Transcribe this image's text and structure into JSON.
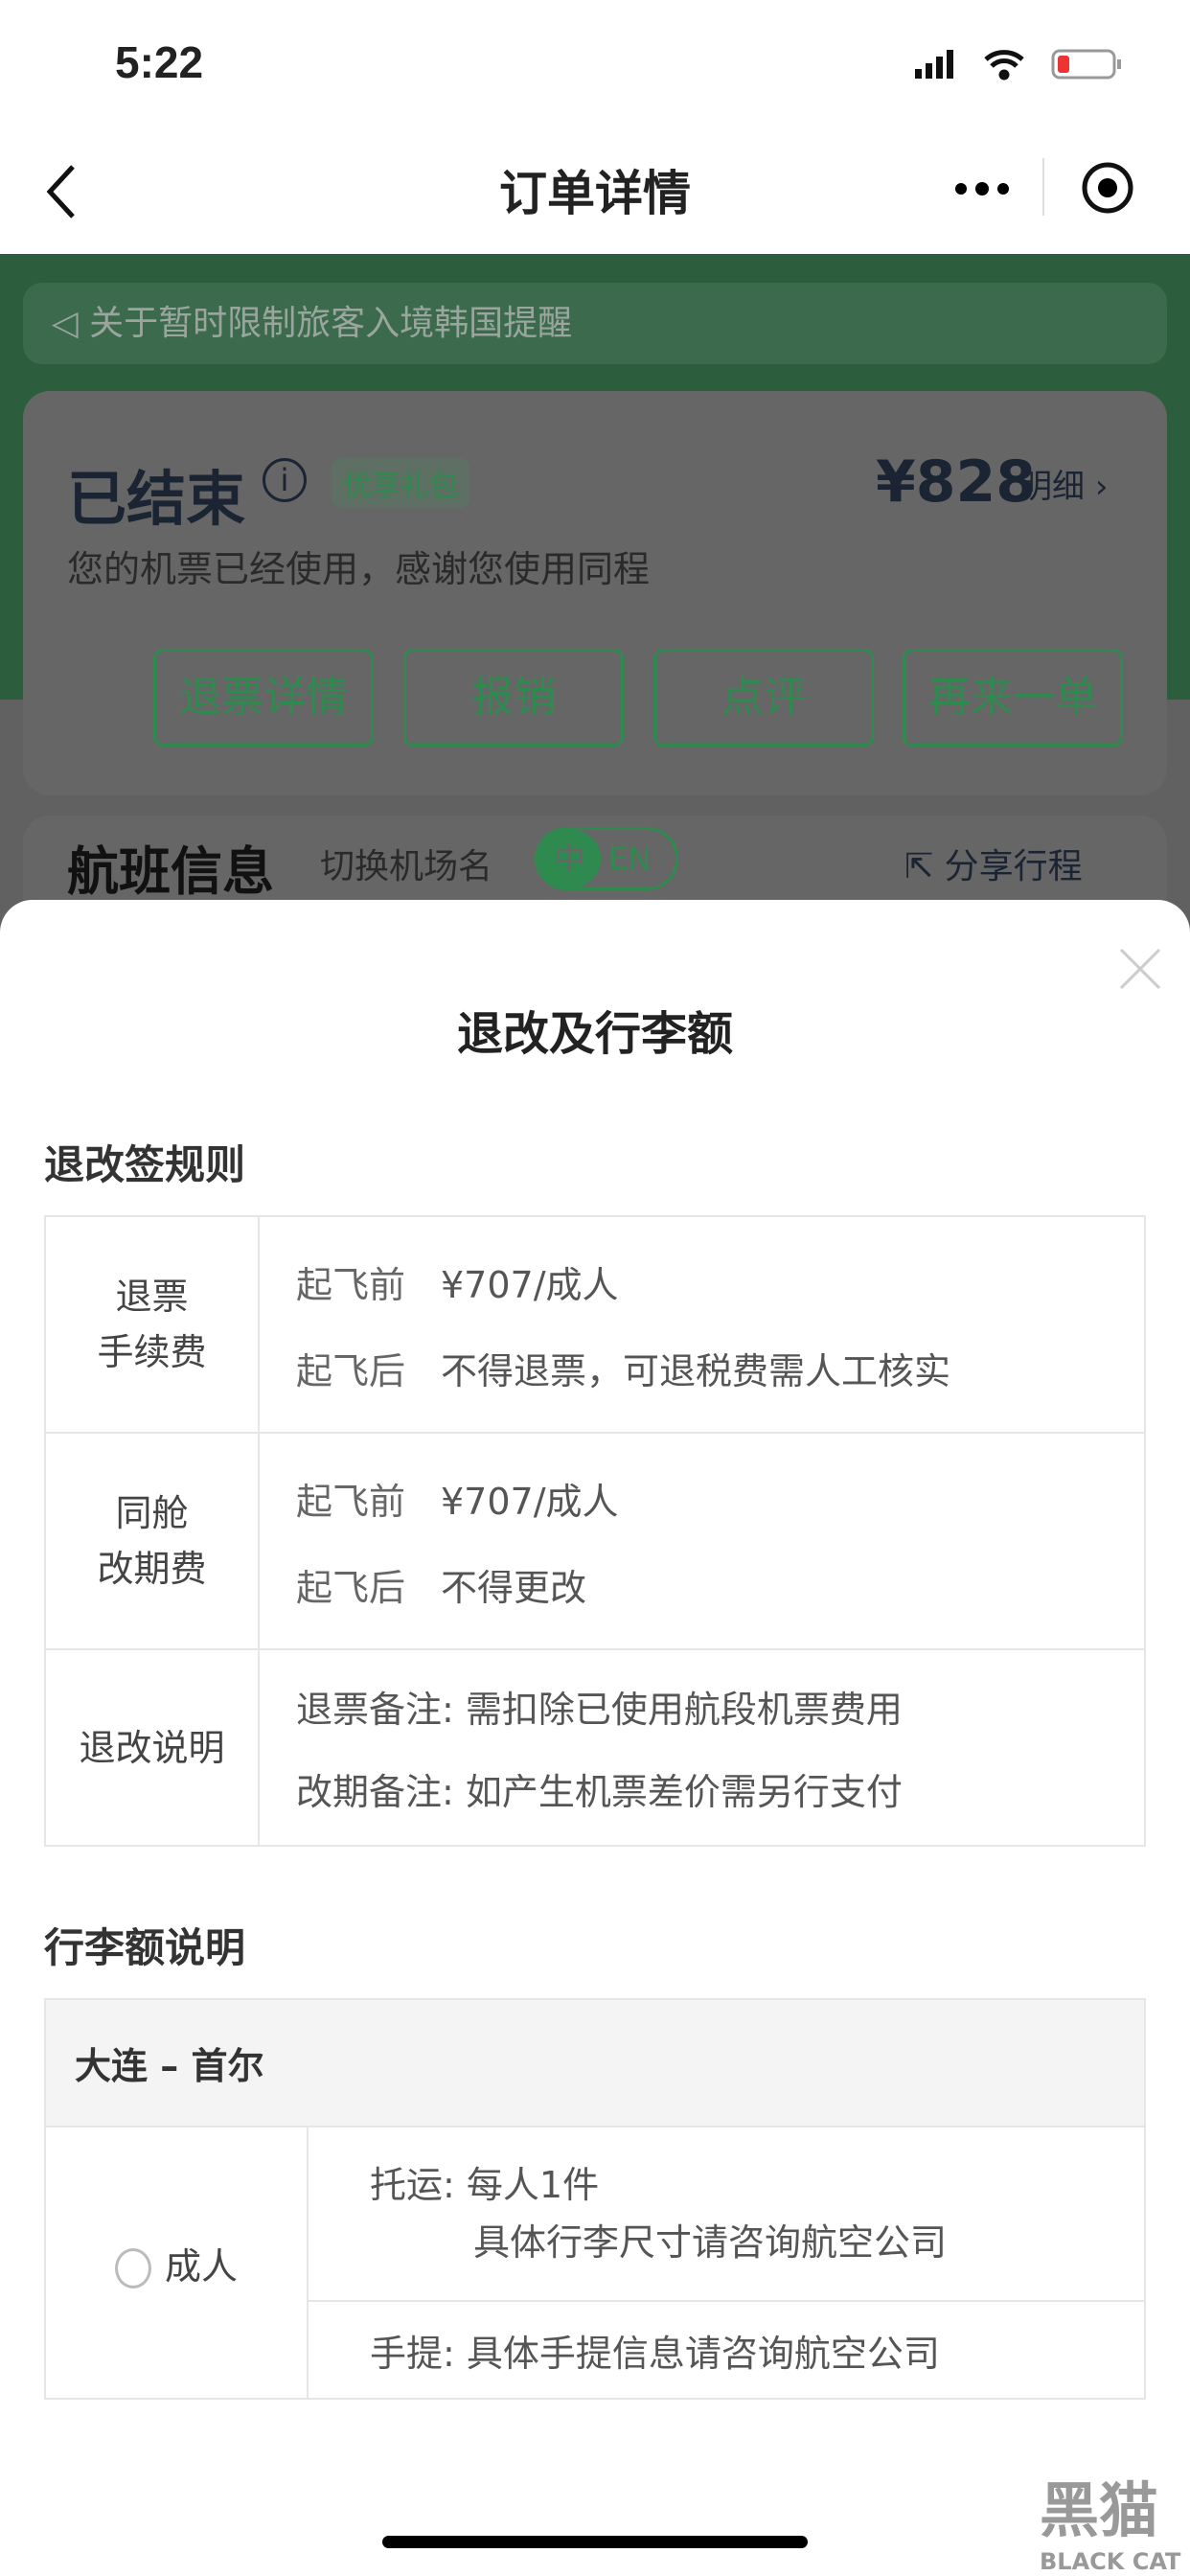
{
  "status_bar": {
    "time": "5:22"
  },
  "nav": {
    "title": "订单详情",
    "more_icon": "more-dots-icon",
    "target_icon": "miniapp-target-icon",
    "back_icon": "chevron-left-icon"
  },
  "notice": {
    "text": "关于暂时限制旅客入境韩国提醒",
    "icon": "speaker-icon"
  },
  "order": {
    "status": "已结束",
    "badge": "优享礼包",
    "price": "¥828",
    "detail_label": "明细",
    "message": "您的机票已经使用，感谢您使用同程",
    "buttons": [
      "退票详情",
      "报销",
      "点评",
      "再来一单"
    ]
  },
  "flight_info": {
    "title": "航班信息",
    "switch_label": "切换机场名",
    "lang_zh": "中",
    "lang_en": "EN",
    "share": "分享行程"
  },
  "sheet": {
    "title": "退改及行李额",
    "rules_title": "退改签规则",
    "rules": [
      {
        "label1": "退票",
        "label2": "手续费",
        "lines": [
          {
            "k": "起飞前",
            "v": "¥707/成人"
          },
          {
            "k": "起飞后",
            "v": "不得退票，可退税费需人工核实"
          }
        ]
      },
      {
        "label1": "同舱",
        "label2": "改期费",
        "lines": [
          {
            "k": "起飞前",
            "v": "¥707/成人"
          },
          {
            "k": "起飞后",
            "v": "不得更改"
          }
        ]
      }
    ],
    "notes_label": "退改说明",
    "notes": [
      "退票备注: 需扣除已使用航段机票费用",
      "改期备注: 如产生机票差价需另行支付"
    ],
    "baggage_title": "行李额说明",
    "route": "大连 – 首尔",
    "passenger": "成人",
    "checked_label": "托运:",
    "checked_1": "每人1件",
    "checked_2": "具体行李尺寸请咨询航空公司",
    "carry_label": "手提:",
    "carry": "具体手提信息请咨询航空公司"
  },
  "watermark": {
    "text_cn": "黑猫",
    "text_en": "BLACK CAT"
  }
}
